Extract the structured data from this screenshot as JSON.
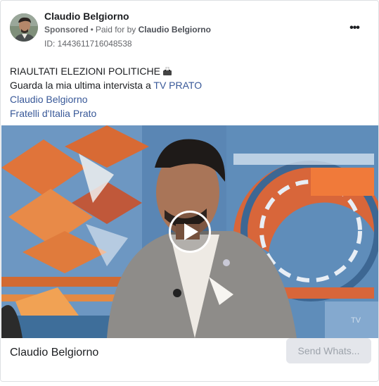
{
  "advertiser": {
    "name": "Claudio Belgiorno",
    "sponsored_label": "Sponsored",
    "separator": "•",
    "paid_for_prefix": "Paid for by",
    "payer": "Claudio Belgiorno",
    "id_text": "ID: 1443611716048538"
  },
  "menu": {
    "more_label": "•••"
  },
  "post": {
    "line1": "RIAULTATI ELEZIONI POLITICHE",
    "line2_prefix": "Guarda la mia ultima intervista a ",
    "line2_link": "TV PRATO",
    "line3_link": "Claudio Belgiorno",
    "line4_link": "Fratelli d'Italia Prato",
    "emoji_icon": "ballot-box-icon"
  },
  "media": {
    "type": "video",
    "play_icon": "play-icon"
  },
  "footer": {
    "title": "Claudio Belgiorno",
    "cta_label": "Send Whats..."
  },
  "colors": {
    "link": "#385898",
    "secondary_text": "#65676b",
    "cta_bg": "#e4e6eb",
    "cta_text": "#9da3ab"
  }
}
